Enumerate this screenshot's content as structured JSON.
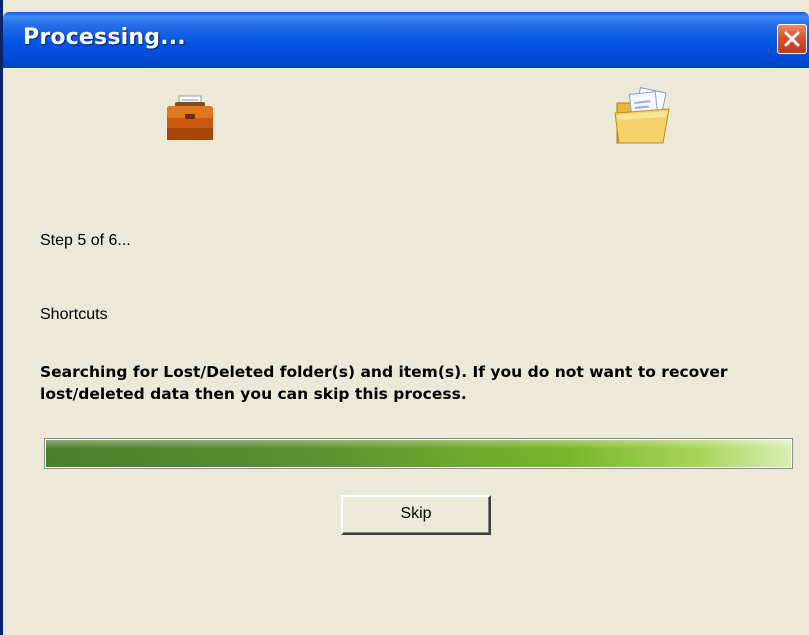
{
  "window": {
    "title": "Processing..."
  },
  "icons": {
    "source": "briefcase-icon",
    "destination": "folder-icon",
    "close": "close-icon"
  },
  "status": {
    "step": "Step 5 of 6...",
    "item": "Shortcuts",
    "description": "Searching for Lost/Deleted folder(s) and item(s). If you do not want to recover lost/deleted data then you can skip this process."
  },
  "progress": {
    "fraction": 1.0
  },
  "buttons": {
    "skip_label": "Skip"
  },
  "colors": {
    "titlebar": "#0054e3",
    "client_bg": "#ece9d8",
    "progress": "#6aa52c"
  }
}
